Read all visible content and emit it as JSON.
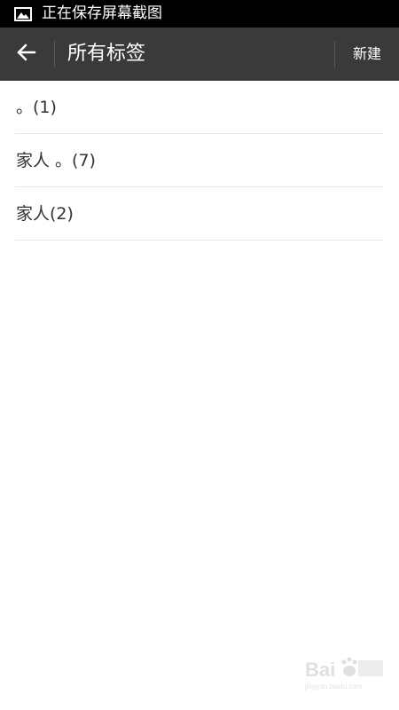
{
  "status_bar": {
    "icon": "image-icon",
    "text": "正在保存屏幕截图"
  },
  "app_bar": {
    "back_icon": "arrow-left-icon",
    "title": "所有标签",
    "new_label": "新建"
  },
  "tags": [
    {
      "label": "。(1)"
    },
    {
      "label": "家人 。(7)"
    },
    {
      "label": "家人(2)"
    }
  ],
  "watermark": {
    "text": "Baidu 经验",
    "url": "jingyan.baidu.com"
  },
  "colors": {
    "status_bar_bg": "#000000",
    "app_bar_bg": "#3a3a3a",
    "background": "#ffffff",
    "item_text": "#333333",
    "divider": "#e6e6e6"
  }
}
